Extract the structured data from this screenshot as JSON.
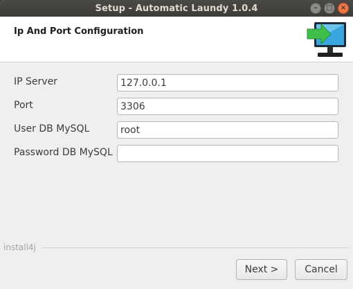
{
  "window": {
    "title": "Setup - Automatic Laundy 1.0.4",
    "controls": {
      "minimize": "–",
      "maximize": "□",
      "close": "×"
    }
  },
  "header": {
    "title": "Ip And Port Configuration",
    "icon": "monitor-arrow-icon"
  },
  "form": {
    "fields": [
      {
        "label": "IP Server",
        "value": "127.0.0.1",
        "placeholder": ""
      },
      {
        "label": "Port",
        "value": "3306",
        "placeholder": ""
      },
      {
        "label": "User DB MySQL",
        "value": "root",
        "placeholder": ""
      },
      {
        "label": "Password DB MySQL",
        "value": "",
        "placeholder": ""
      }
    ]
  },
  "footer": {
    "brand": "install4j",
    "next_label": "Next >",
    "cancel_label": "Cancel"
  },
  "colors": {
    "titlebar": "#3e3d39",
    "close_button": "#f07746",
    "icon_arrow": "#3fbf4a",
    "icon_screen": "#39a7df"
  }
}
